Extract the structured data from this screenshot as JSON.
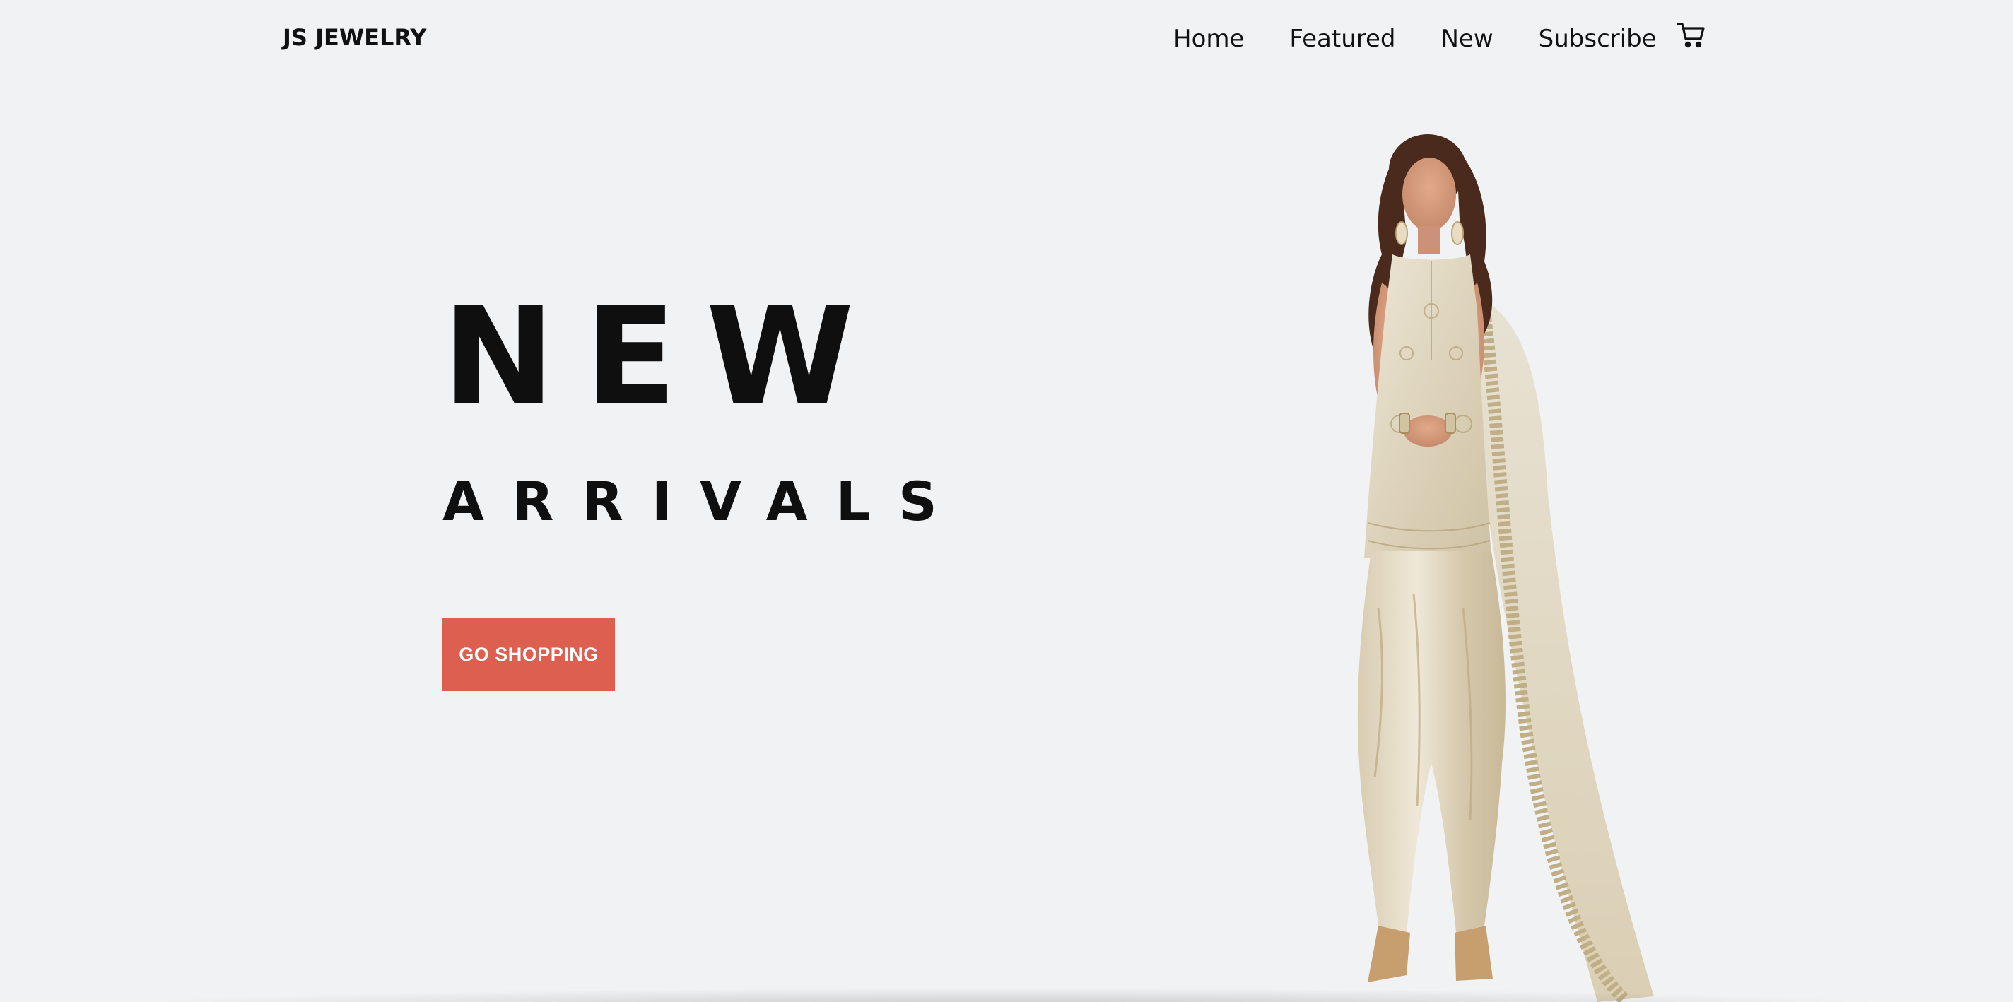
{
  "header": {
    "brand": "JS JEWELRY",
    "nav": [
      {
        "label": "Home"
      },
      {
        "label": "Featured"
      },
      {
        "label": "New"
      },
      {
        "label": "Subscribe"
      }
    ],
    "cart_icon": "cart-icon"
  },
  "hero": {
    "title": "NEW",
    "subtitle": "ARRIVALS",
    "cta_label": "GO SHOPPING",
    "cta_color": "#dc5f50"
  },
  "image": {
    "subject": "model-photo"
  },
  "colors": {
    "background": "#f1f2f4",
    "text": "#111111",
    "accent": "#dc5f50"
  }
}
